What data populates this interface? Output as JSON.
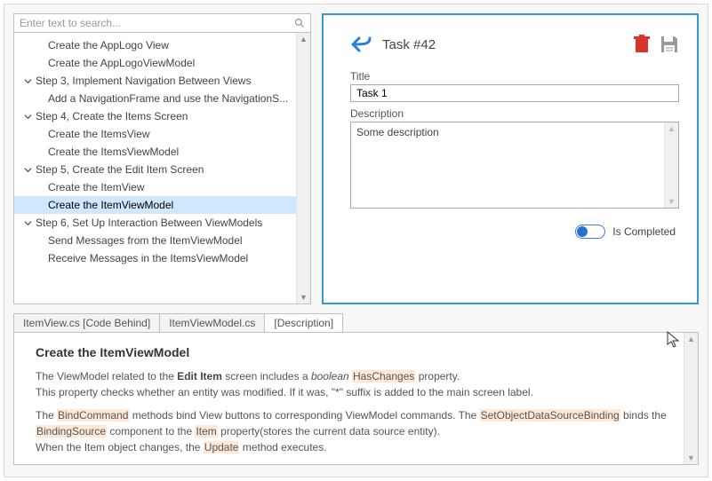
{
  "search": {
    "placeholder": "Enter text to search..."
  },
  "tree": {
    "items": [
      {
        "type": "child",
        "label": "Create the AppLogo View"
      },
      {
        "type": "child",
        "label": "Create the AppLogoViewModel"
      },
      {
        "type": "parent",
        "label": "Step 3, Implement Navigation Between Views"
      },
      {
        "type": "child",
        "label": "Add a NavigationFrame and use the NavigationS..."
      },
      {
        "type": "parent",
        "label": "Step 4, Create the Items Screen"
      },
      {
        "type": "child",
        "label": "Create the ItemsView"
      },
      {
        "type": "child",
        "label": "Create the ItemsViewModel"
      },
      {
        "type": "parent",
        "label": "Step 5, Create the Edit Item Screen"
      },
      {
        "type": "child",
        "label": "Create the ItemView"
      },
      {
        "type": "child",
        "label": "Create the ItemViewModel",
        "selected": true
      },
      {
        "type": "parent",
        "label": "Step 6, Set Up Interaction Between ViewModels"
      },
      {
        "type": "child",
        "label": "Send Messages from the ItemViewModel"
      },
      {
        "type": "child",
        "label": "Receive Messages in the ItemsViewModel"
      }
    ]
  },
  "detail": {
    "caption": "Task #42",
    "title_label": "Title",
    "title_value": "Task 1",
    "desc_label": "Description",
    "desc_value": "Some description",
    "completed_label": "Is Completed"
  },
  "tabs": [
    {
      "label": "ItemView.cs [Code Behind]"
    },
    {
      "label": "ItemViewModel.cs"
    },
    {
      "label": "[Description]",
      "active": true
    }
  ],
  "doc": {
    "heading": "Create the ItemViewModel",
    "p1_a": "The ViewModel related to the ",
    "p1_b": "Edit Item",
    "p1_c": " screen includes a ",
    "p1_d": "boolean",
    "p1_e": "HasChanges",
    "p1_f": " property.",
    "p1_g": "This property checks whether an entity was modified. If it was, \"*\" suffix is added to the main screen label.",
    "p2_a": "The ",
    "p2_b": "BindCommand",
    "p2_c": " methods bind View buttons to corresponding ViewModel commands. The ",
    "p2_d": "SetObjectDataSourceBinding",
    "p2_e": " binds the ",
    "p2_f": "BindingSource",
    "p2_g": " component to the ",
    "p2_h": "Item",
    "p2_i": " property(stores the current data source entity).",
    "p2_j": "When the Item object changes, the ",
    "p2_k": "Update",
    "p2_l": " method executes."
  }
}
